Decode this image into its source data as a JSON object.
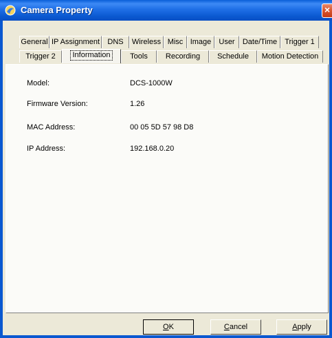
{
  "window": {
    "title": "Camera Property"
  },
  "tabs": {
    "row1": [
      "General",
      "IP Assignment",
      "DNS",
      "Wireless",
      "Misc",
      "Image",
      "User",
      "Date/Time",
      "Trigger 1"
    ],
    "row2": [
      "Trigger 2",
      "Information",
      "Tools",
      "Recording",
      "Schedule",
      "Motion Detection"
    ],
    "active": "Information"
  },
  "info": {
    "model_label": "Model:",
    "model_value": "DCS-1000W",
    "firmware_label": "Firmware Version:",
    "firmware_value": "1.26",
    "mac_label": "MAC Address:",
    "mac_value": "00 05 5D 57 98 D8",
    "ip_label": "IP Address:",
    "ip_value": "192.168.0.20"
  },
  "buttons": {
    "ok_mnemonic": "O",
    "ok_rest": "K",
    "cancel_mnemonic": "C",
    "cancel_rest": "ancel",
    "apply_mnemonic": "A",
    "apply_rest": "pply"
  },
  "colors": {
    "titlebar": "#0a58d0",
    "dialog_bg": "#ece9d8",
    "close_button": "#d8542e"
  },
  "icons": {
    "title": "camera-app-icon",
    "close": "close-icon"
  }
}
